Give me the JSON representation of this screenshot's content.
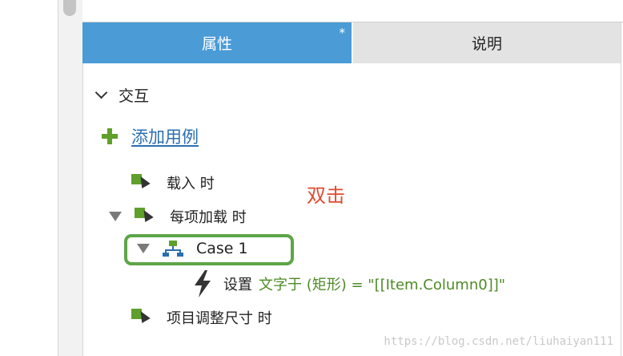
{
  "tabs": {
    "properties_label": "属性",
    "properties_dirty_marker": "*",
    "notes_label": "说明"
  },
  "interactions": {
    "section_title": "交互",
    "add_case_label": "添加用例",
    "events": [
      {
        "label": "载入 时"
      },
      {
        "label": "每项加载 时"
      },
      {
        "label": "项目调整尺寸 时"
      }
    ],
    "case": {
      "label": "Case 1",
      "action_verb": "设置",
      "action_detail": "文字于 (矩形) = \"[[Item.Column0]]\""
    }
  },
  "annotation": {
    "text": "双击",
    "color": "#e04a2f"
  },
  "watermark": "https://blog.csdn.net/liuhaiyan111",
  "colors": {
    "active_tab": "#4a9bd6",
    "inactive_tab": "#e3e3e3",
    "green_icon": "#5fa02c",
    "link": "#2a6fb0",
    "highlight_box": "#5ea548",
    "action_detail": "#4e8a26"
  },
  "icons": {
    "collapse": "chevron-down-icon",
    "add": "plus-icon",
    "event": "event-cursor-icon",
    "expand_triangle": "triangle-down-icon",
    "case": "case-tree-icon",
    "action": "lightning-icon"
  }
}
